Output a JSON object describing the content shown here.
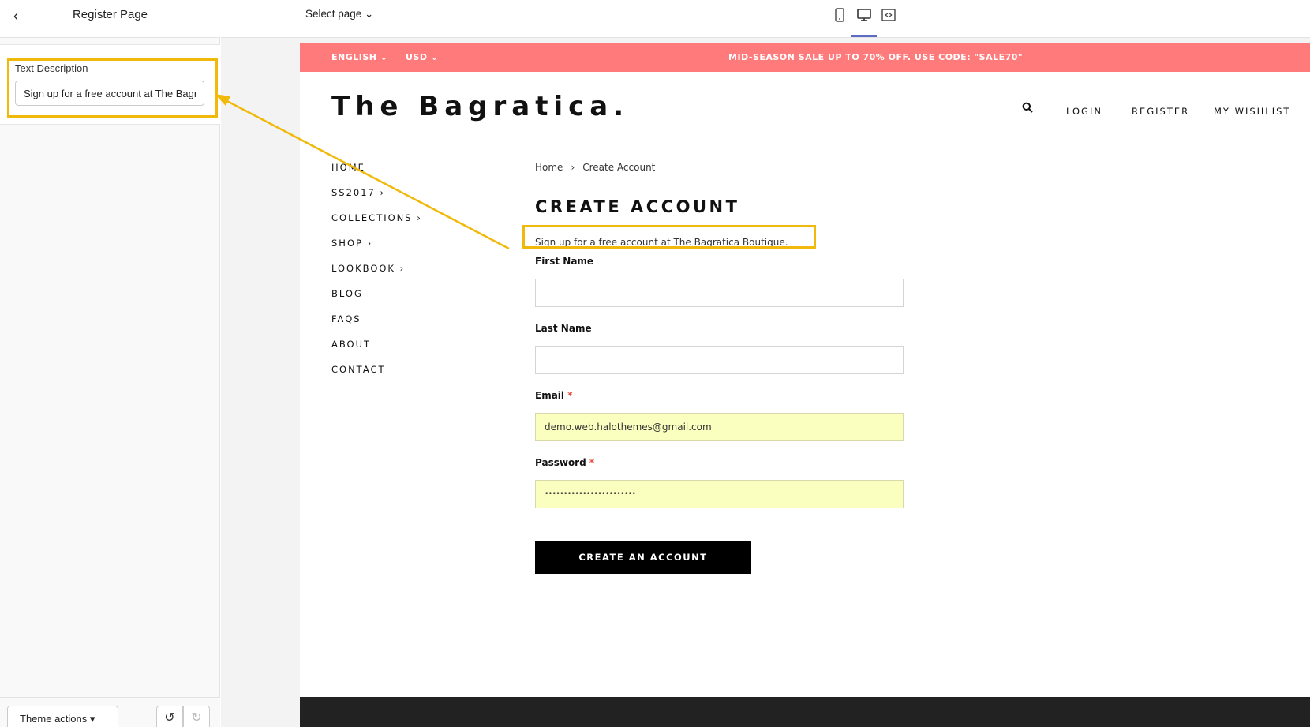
{
  "editor": {
    "sidebar_title": "Register Page",
    "field_label": "Text Description",
    "field_value": "Sign up for a free account at The Bagratica Boutique.",
    "theme_actions_label": "Theme actions ▾",
    "select_page_label": "Select page ⌄",
    "device_icons": [
      "mobile-icon",
      "desktop-icon",
      "fullscreen-icon"
    ],
    "highlight_color": "#f0b90b",
    "active_device_color": "#5c6ac4"
  },
  "announcement": {
    "language": "ENGLISH ⌄",
    "currency": "USD ⌄",
    "message": "MID-SEASON SALE UP TO 70% OFF. USE CODE: \"SALE70\"",
    "bg_color": "#ff7b7b"
  },
  "header": {
    "logo": "The Bagratica.",
    "links": [
      "LOGIN",
      "REGISTER",
      "MY WISHLIST"
    ]
  },
  "nav": [
    "HOME",
    "SS2017 ›",
    "COLLECTIONS ›",
    "SHOP ›",
    "LOOKBOOK ›",
    "BLOG",
    "FAQS",
    "ABOUT",
    "CONTACT"
  ],
  "breadcrumb": {
    "home": "Home",
    "separator": "›",
    "current": "Create Account"
  },
  "form": {
    "title": "CREATE ACCOUNT",
    "description": "Sign up for a free account at The Bagratica Boutique.",
    "first_name_label": "First Name",
    "first_name_value": "",
    "last_name_label": "Last Name",
    "last_name_value": "",
    "email_label": "Email",
    "email_value": "demo.web.halothemes@gmail.com",
    "password_label": "Password",
    "password_value": "••••••••••••••••••••••••",
    "required_mark": "*",
    "submit_label": "CREATE AN ACCOUNT"
  }
}
